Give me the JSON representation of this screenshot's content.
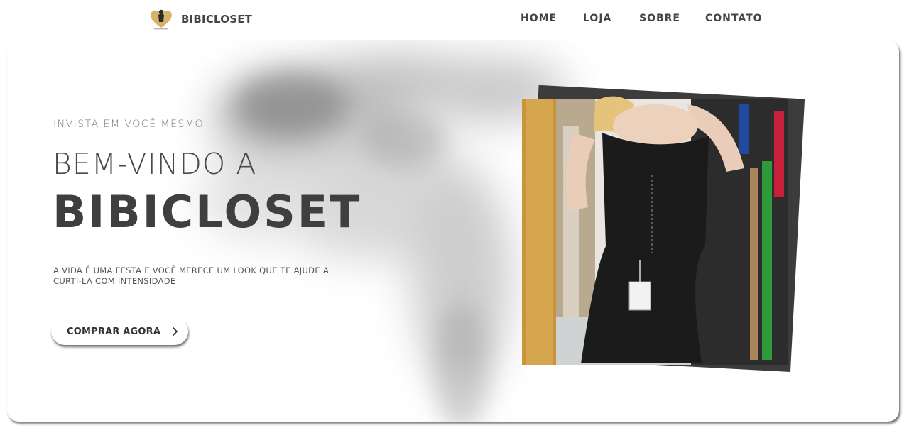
{
  "header": {
    "logo_text": "BIBICLOSET",
    "nav": [
      {
        "label": "HOME"
      },
      {
        "label": "LOJA"
      },
      {
        "label": "SOBRE"
      },
      {
        "label": "CONTATO"
      }
    ]
  },
  "hero": {
    "eyebrow": "INVISTA EM VOCÊ MESMO",
    "welcome": "BEM-VINDO A",
    "brand": "BIBICLOSET",
    "description": "A VIDA É UMA FESTA E VOCÊ MERECE UM LOOK QUE TE AJUDE A CURTI-LA COM INTENSIDADE",
    "cta_label": "COMPRAR AGORA",
    "cta_icon": "chevron-right-icon",
    "image": "model-mirror-selfie-photo"
  },
  "colors": {
    "text_dark": "#3f3f3f",
    "text_muted": "#7a7a7a",
    "background": "#ffffff",
    "gold": "#d4a24a"
  }
}
